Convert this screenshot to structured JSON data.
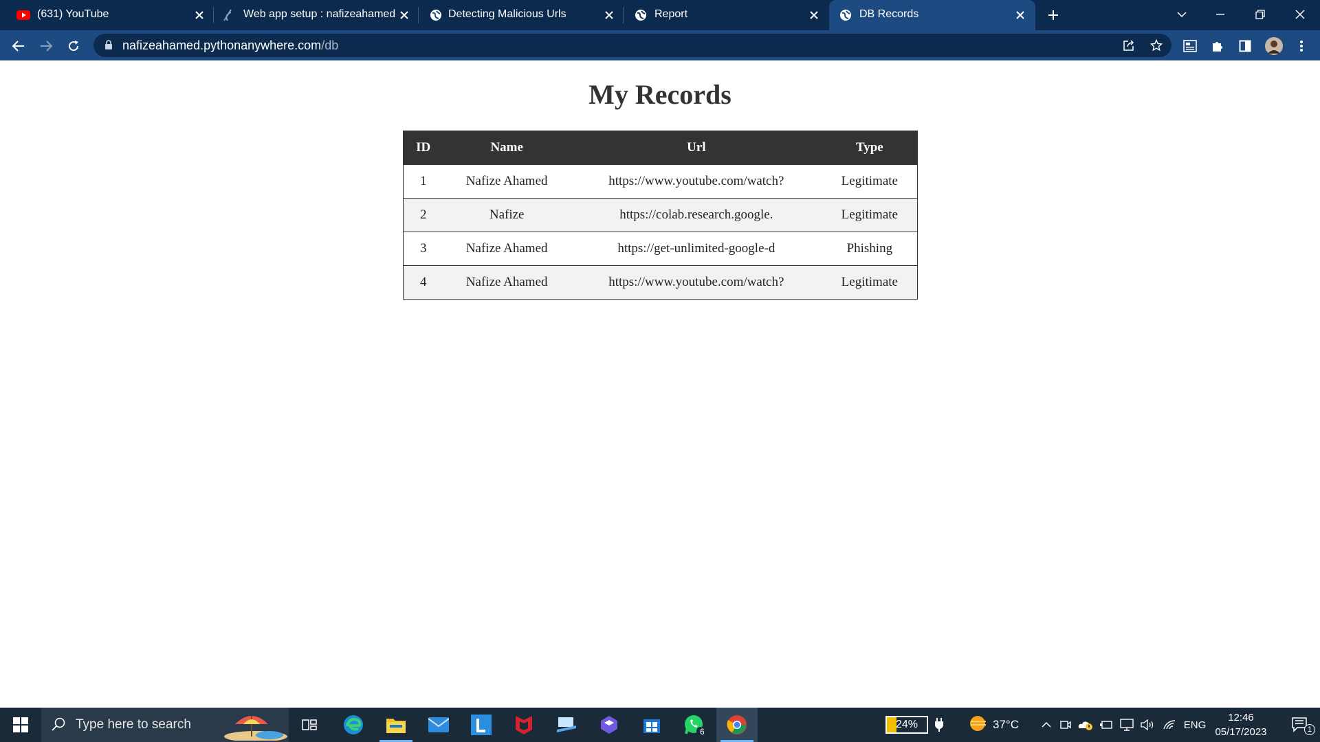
{
  "browser": {
    "tabs": [
      {
        "title": "(631) YouTube",
        "icon": "youtube-icon"
      },
      {
        "title": "Web app setup : nafizeahamed : ",
        "icon": "pythonanywhere-icon"
      },
      {
        "title": "Detecting Malicious Urls",
        "icon": "globe-icon"
      },
      {
        "title": "Report",
        "icon": "globe-icon"
      },
      {
        "title": "DB Records",
        "icon": "globe-icon",
        "active": true
      }
    ],
    "url_host": "nafizeahamed.pythonanywhere.com",
    "url_path": "/db"
  },
  "page": {
    "title": "My Records",
    "table": {
      "headers": [
        "ID",
        "Name",
        "Url",
        "Type"
      ],
      "rows": [
        [
          "1",
          "Nafize Ahamed",
          "https://www.youtube.com/watch?",
          "Legitimate"
        ],
        [
          "2",
          "Nafize",
          "https://colab.research.google.",
          "Legitimate"
        ],
        [
          "3",
          "Nafize Ahamed",
          "https://get-unlimited-google-d",
          "Phishing"
        ],
        [
          "4",
          "Nafize Ahamed",
          "https://www.youtube.com/watch?",
          "Legitimate"
        ]
      ]
    }
  },
  "taskbar": {
    "search_placeholder": "Type here to search",
    "battery_percent": "24%",
    "battery_level": 0.24,
    "temperature": "37°C",
    "language": "ENG",
    "time": "12:46",
    "date": "05/17/2023",
    "whatsapp_badge": "6",
    "notification_count": "1"
  },
  "colors": {
    "tab_strip": "#0c2a4d",
    "toolbar": "#1d4a80",
    "table_header": "#333333",
    "taskbar": "#1b2a38"
  }
}
